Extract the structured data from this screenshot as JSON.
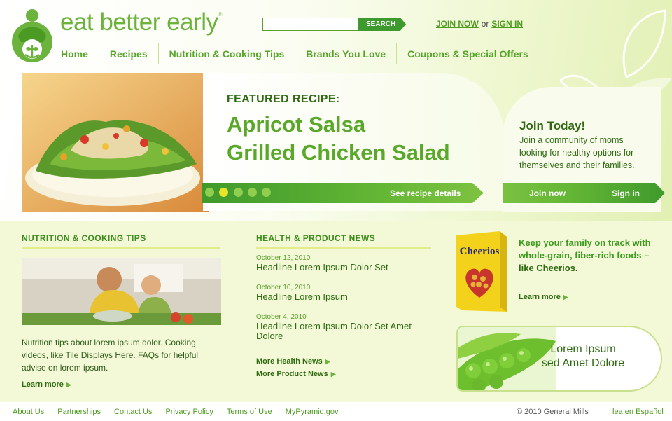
{
  "brand": {
    "name": "eat better early",
    "trademark": "®"
  },
  "header": {
    "search": {
      "value": "",
      "placeholder": "",
      "button_label": "SEARCH"
    },
    "join_label": "JOIN NOW",
    "or_label": "or",
    "signin_label": "SIGN IN"
  },
  "nav": {
    "items": [
      {
        "label": "Home"
      },
      {
        "label": "Recipes"
      },
      {
        "label": "Nutrition & Cooking Tips"
      },
      {
        "label": "Brands You Love"
      },
      {
        "label": "Coupons & Special Offers"
      }
    ]
  },
  "hero": {
    "label": "FEATURED RECIPE:",
    "title_line1": "Apricot Salsa",
    "title_line2": "Grilled Chicken Salad",
    "link_label": "See recipe details",
    "slides_count": 5,
    "active_slide": 2
  },
  "join": {
    "title": "Join Today!",
    "description": "Join a community of moms looking for healthy options for themselves and their families.",
    "join_label": "Join now",
    "signin_label": "Sign in"
  },
  "tips": {
    "title": "NUTRITION & COOKING TIPS",
    "text": "Nutrition tips about lorem ipsum dolor. Cooking videos, like Tile Displays Here. FAQs for helpful advise on lorem ipsum.",
    "learn_more": "Learn more"
  },
  "news": {
    "title": "HEALTH & PRODUCT NEWS",
    "items": [
      {
        "date": "October 12, 2010",
        "headline": "Headline Lorem Ipsum Dolor Set"
      },
      {
        "date": "October 10, 2010",
        "headline": "Headline Lorem Ipsum"
      },
      {
        "date": "October 4, 2010",
        "headline": "Headline Lorem Ipsum Dolor Set Amet Dolore"
      }
    ],
    "more_health": "More Health News",
    "more_product": "More Product News"
  },
  "promo": {
    "box_label": "Cheerios",
    "line1": "Keep your family on track with whole-grain, fiber-rich foods –",
    "line2": "like Cheerios.",
    "learn_more": "Learn more"
  },
  "peas": {
    "line1": "Lorem Ipsum",
    "line2": "sed Amet Dolore"
  },
  "footer": {
    "links": [
      {
        "label": "About Us"
      },
      {
        "label": "Partnerships"
      },
      {
        "label": "Contact Us"
      },
      {
        "label": "Privacy Policy"
      },
      {
        "label": "Terms of Use"
      },
      {
        "label": "MyPyramid.gov"
      }
    ],
    "copyright": "© 2010 General Mills",
    "language_link": "lea en Español"
  },
  "colors": {
    "brand_green": "#6cb33e",
    "dark_green": "#2f6a12",
    "button_green": "#3e9a2e",
    "accent_yellow": "#e7e52a"
  }
}
